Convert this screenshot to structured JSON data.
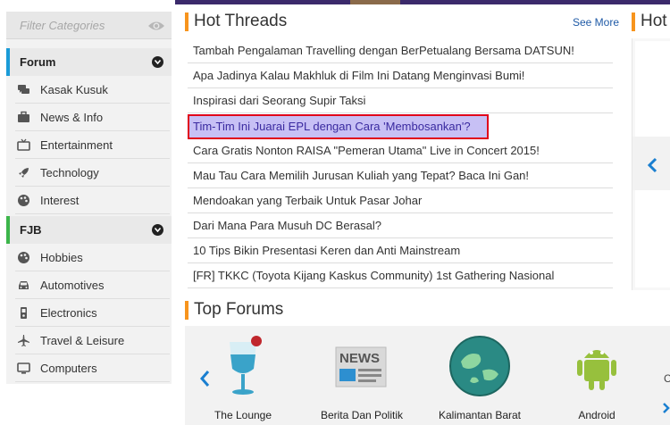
{
  "sidebar": {
    "filter_placeholder": "Filter Categories",
    "sections": [
      {
        "label": "Forum",
        "accent": "#1a9bd7",
        "items": [
          {
            "label": "Kasak Kusuk",
            "icon": "chat-icon"
          },
          {
            "label": "News & Info",
            "icon": "briefcase-icon"
          },
          {
            "label": "Entertainment",
            "icon": "tv-icon"
          },
          {
            "label": "Technology",
            "icon": "rocket-icon"
          },
          {
            "label": "Interest",
            "icon": "palette-icon"
          }
        ]
      },
      {
        "label": "FJB",
        "accent": "#3cb54a",
        "items": [
          {
            "label": "Hobbies",
            "icon": "palette-icon"
          },
          {
            "label": "Automotives",
            "icon": "car-icon"
          },
          {
            "label": "Electronics",
            "icon": "device-icon"
          },
          {
            "label": "Travel & Leisure",
            "icon": "plane-icon"
          },
          {
            "label": "Computers",
            "icon": "monitor-icon"
          }
        ]
      }
    ]
  },
  "hot_threads": {
    "title": "Hot Threads",
    "see_more": "See More",
    "threads": [
      "Tambah Pengalaman Travelling dengan BerPetualang Bersama DATSUN!",
      "Apa Jadinya Kalau Makhluk di Film Ini Datang Menginvasi Bumi!",
      "Inspirasi dari Seorang Supir Taksi",
      "Tim-Tim Ini Juarai EPL dengan Cara 'Membosankan'?",
      "Cara Gratis Nonton RAISA \"Pemeran Utama\" Live in Concert 2015!",
      "Mau Tau Cara Memilih Jurusan Kuliah yang Tepat? Baca Ini Gan!",
      "Mendoakan yang Terbaik Untuk Pasar Johar",
      "Dari Mana Para Musuh DC Berasal?",
      "10 Tips Bikin Presentasi Keren dan Anti Mainstream",
      "[FR] TKKC (Toyota Kijang Kaskus Community) 1st Gathering Nasional"
    ],
    "highlighted_index": 3
  },
  "right_panel": {
    "title": "Hot"
  },
  "top_forums": {
    "title": "Top Forums",
    "forums": [
      {
        "label": "The Lounge",
        "icon": "lounge-glass-icon"
      },
      {
        "label": "Berita Dan Politik",
        "icon": "newspaper-icon"
      },
      {
        "label": "Kalimantan Barat",
        "icon": "globe-icon"
      },
      {
        "label": "Android",
        "icon": "android-icon"
      }
    ],
    "edge_text": "C"
  },
  "colors": {
    "accent_orange": "#f7941d",
    "link_blue": "#1f5aa6",
    "highlight_bg": "#c7c0f5",
    "highlight_border": "#e0001a"
  }
}
